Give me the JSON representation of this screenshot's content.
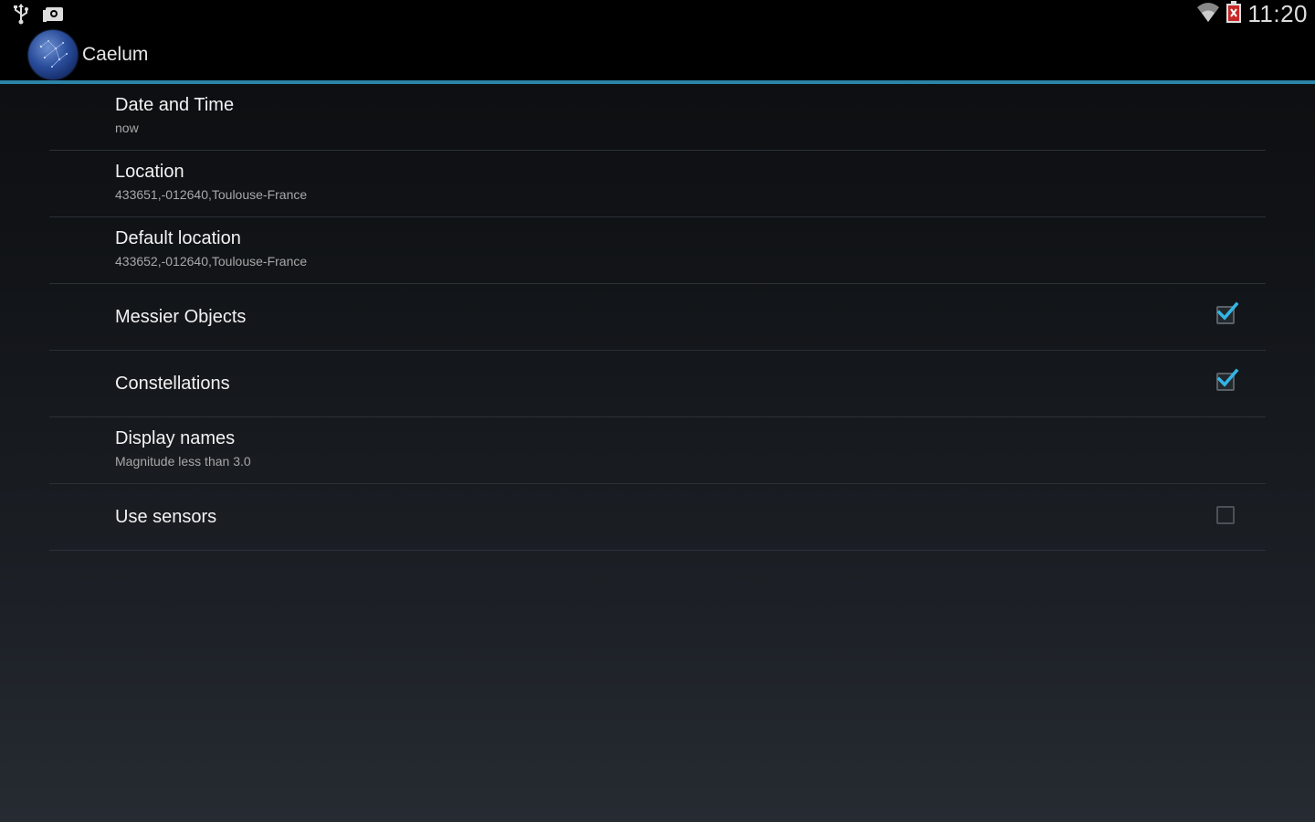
{
  "status_bar": {
    "left_icons": [
      "usb-icon",
      "photo-icon"
    ],
    "right_icons": [
      "wifi-icon",
      "battery-icon"
    ],
    "time": "11:20"
  },
  "action_bar": {
    "app_icon": "caelum-logo-icon",
    "title": "Caelum",
    "accent_color": "#2a84a8"
  },
  "settings": [
    {
      "title": "Date and Time",
      "summary": "now"
    },
    {
      "title": "Location",
      "summary": "433651,-012640,Toulouse-France"
    },
    {
      "title": "Default location",
      "summary": "433652,-012640,Toulouse-France"
    },
    {
      "title": "Messier Objects",
      "checked": true
    },
    {
      "title": "Constellations",
      "checked": true
    },
    {
      "title": "Display names",
      "summary": "Magnitude less than 3.0"
    },
    {
      "title": "Use sensors",
      "checked": false
    }
  ],
  "colors": {
    "checkmark": "#33b5e5",
    "divider": "#2b3138"
  }
}
